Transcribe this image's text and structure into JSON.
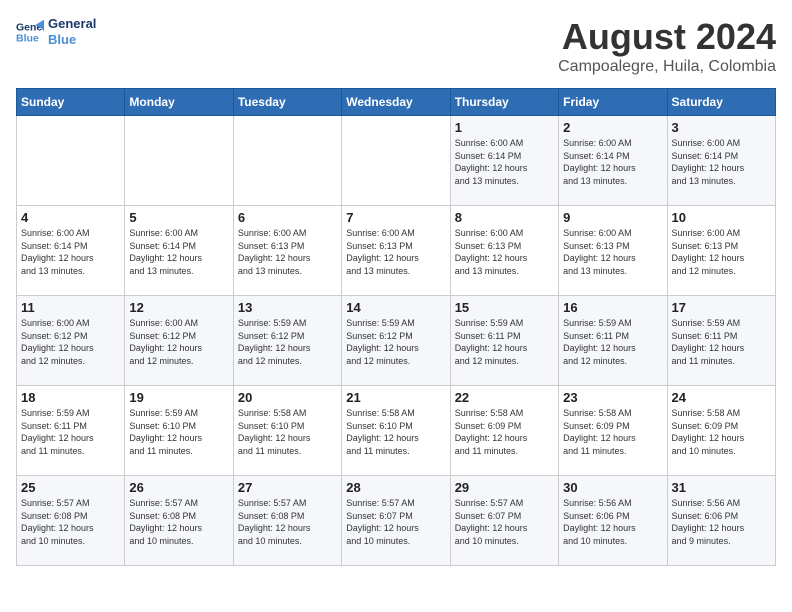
{
  "logo": {
    "line1": "General",
    "line2": "Blue"
  },
  "title": "August 2024",
  "subtitle": "Campoalegre, Huila, Colombia",
  "weekdays": [
    "Sunday",
    "Monday",
    "Tuesday",
    "Wednesday",
    "Thursday",
    "Friday",
    "Saturday"
  ],
  "weeks": [
    [
      {
        "day": "",
        "info": ""
      },
      {
        "day": "",
        "info": ""
      },
      {
        "day": "",
        "info": ""
      },
      {
        "day": "",
        "info": ""
      },
      {
        "day": "1",
        "info": "Sunrise: 6:00 AM\nSunset: 6:14 PM\nDaylight: 12 hours\nand 13 minutes."
      },
      {
        "day": "2",
        "info": "Sunrise: 6:00 AM\nSunset: 6:14 PM\nDaylight: 12 hours\nand 13 minutes."
      },
      {
        "day": "3",
        "info": "Sunrise: 6:00 AM\nSunset: 6:14 PM\nDaylight: 12 hours\nand 13 minutes."
      }
    ],
    [
      {
        "day": "4",
        "info": "Sunrise: 6:00 AM\nSunset: 6:14 PM\nDaylight: 12 hours\nand 13 minutes."
      },
      {
        "day": "5",
        "info": "Sunrise: 6:00 AM\nSunset: 6:14 PM\nDaylight: 12 hours\nand 13 minutes."
      },
      {
        "day": "6",
        "info": "Sunrise: 6:00 AM\nSunset: 6:13 PM\nDaylight: 12 hours\nand 13 minutes."
      },
      {
        "day": "7",
        "info": "Sunrise: 6:00 AM\nSunset: 6:13 PM\nDaylight: 12 hours\nand 13 minutes."
      },
      {
        "day": "8",
        "info": "Sunrise: 6:00 AM\nSunset: 6:13 PM\nDaylight: 12 hours\nand 13 minutes."
      },
      {
        "day": "9",
        "info": "Sunrise: 6:00 AM\nSunset: 6:13 PM\nDaylight: 12 hours\nand 13 minutes."
      },
      {
        "day": "10",
        "info": "Sunrise: 6:00 AM\nSunset: 6:13 PM\nDaylight: 12 hours\nand 12 minutes."
      }
    ],
    [
      {
        "day": "11",
        "info": "Sunrise: 6:00 AM\nSunset: 6:12 PM\nDaylight: 12 hours\nand 12 minutes."
      },
      {
        "day": "12",
        "info": "Sunrise: 6:00 AM\nSunset: 6:12 PM\nDaylight: 12 hours\nand 12 minutes."
      },
      {
        "day": "13",
        "info": "Sunrise: 5:59 AM\nSunset: 6:12 PM\nDaylight: 12 hours\nand 12 minutes."
      },
      {
        "day": "14",
        "info": "Sunrise: 5:59 AM\nSunset: 6:12 PM\nDaylight: 12 hours\nand 12 minutes."
      },
      {
        "day": "15",
        "info": "Sunrise: 5:59 AM\nSunset: 6:11 PM\nDaylight: 12 hours\nand 12 minutes."
      },
      {
        "day": "16",
        "info": "Sunrise: 5:59 AM\nSunset: 6:11 PM\nDaylight: 12 hours\nand 12 minutes."
      },
      {
        "day": "17",
        "info": "Sunrise: 5:59 AM\nSunset: 6:11 PM\nDaylight: 12 hours\nand 11 minutes."
      }
    ],
    [
      {
        "day": "18",
        "info": "Sunrise: 5:59 AM\nSunset: 6:11 PM\nDaylight: 12 hours\nand 11 minutes."
      },
      {
        "day": "19",
        "info": "Sunrise: 5:59 AM\nSunset: 6:10 PM\nDaylight: 12 hours\nand 11 minutes."
      },
      {
        "day": "20",
        "info": "Sunrise: 5:58 AM\nSunset: 6:10 PM\nDaylight: 12 hours\nand 11 minutes."
      },
      {
        "day": "21",
        "info": "Sunrise: 5:58 AM\nSunset: 6:10 PM\nDaylight: 12 hours\nand 11 minutes."
      },
      {
        "day": "22",
        "info": "Sunrise: 5:58 AM\nSunset: 6:09 PM\nDaylight: 12 hours\nand 11 minutes."
      },
      {
        "day": "23",
        "info": "Sunrise: 5:58 AM\nSunset: 6:09 PM\nDaylight: 12 hours\nand 11 minutes."
      },
      {
        "day": "24",
        "info": "Sunrise: 5:58 AM\nSunset: 6:09 PM\nDaylight: 12 hours\nand 10 minutes."
      }
    ],
    [
      {
        "day": "25",
        "info": "Sunrise: 5:57 AM\nSunset: 6:08 PM\nDaylight: 12 hours\nand 10 minutes."
      },
      {
        "day": "26",
        "info": "Sunrise: 5:57 AM\nSunset: 6:08 PM\nDaylight: 12 hours\nand 10 minutes."
      },
      {
        "day": "27",
        "info": "Sunrise: 5:57 AM\nSunset: 6:08 PM\nDaylight: 12 hours\nand 10 minutes."
      },
      {
        "day": "28",
        "info": "Sunrise: 5:57 AM\nSunset: 6:07 PM\nDaylight: 12 hours\nand 10 minutes."
      },
      {
        "day": "29",
        "info": "Sunrise: 5:57 AM\nSunset: 6:07 PM\nDaylight: 12 hours\nand 10 minutes."
      },
      {
        "day": "30",
        "info": "Sunrise: 5:56 AM\nSunset: 6:06 PM\nDaylight: 12 hours\nand 10 minutes."
      },
      {
        "day": "31",
        "info": "Sunrise: 5:56 AM\nSunset: 6:06 PM\nDaylight: 12 hours\nand 9 minutes."
      }
    ]
  ]
}
